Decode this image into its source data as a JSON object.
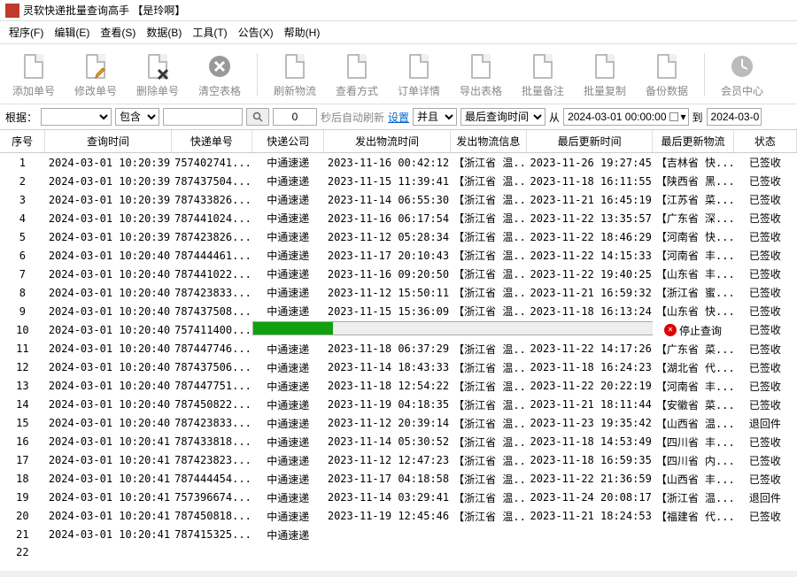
{
  "window": {
    "title": "灵软快递批量查询高手 【是玲啊】"
  },
  "menu": [
    "程序(F)",
    "编辑(E)",
    "查看(S)",
    "数据(B)",
    "工具(T)",
    "公告(X)",
    "帮助(H)"
  ],
  "toolbar": [
    {
      "label": "添加单号"
    },
    {
      "label": "修改单号"
    },
    {
      "label": "删除单号"
    },
    {
      "label": "清空表格"
    },
    {
      "sep": true
    },
    {
      "label": "刷新物流"
    },
    {
      "label": "查看方式"
    },
    {
      "label": "订单详情"
    },
    {
      "label": "导出表格"
    },
    {
      "label": "批量备注"
    },
    {
      "label": "批量复制"
    },
    {
      "label": "备份数据"
    },
    {
      "sep": true
    },
    {
      "label": "会员中心"
    }
  ],
  "filter": {
    "root_label": "根据：",
    "contains": "包含",
    "num": "0",
    "auto_refresh": "秒后自动刷新",
    "settings": "设置",
    "and": "并且",
    "last_query_time": "最后查询时间",
    "from": "从",
    "date1": "2024-03-01 00:00:00",
    "to": "到",
    "date2": "2024-03-0"
  },
  "columns": [
    "序号",
    "查询时间",
    "快递单号",
    "快递公司",
    "发出物流时间",
    "发出物流信息",
    "最后更新时间",
    "最后更新物流",
    "状态"
  ],
  "rows": [
    {
      "seq": "1",
      "qtime": "2024-03-01 10:20:39",
      "trackno": "757402741...",
      "company": "中通速递",
      "shiptime": "2023-11-16 00:42:12",
      "shipinfo": "【浙江省 温...",
      "lasttime": "2023-11-26 19:27:45",
      "lastinfo": "【吉林省 快...",
      "status": "已签收"
    },
    {
      "seq": "2",
      "qtime": "2024-03-01 10:20:39",
      "trackno": "787437504...",
      "company": "中通速递",
      "shiptime": "2023-11-15 11:39:41",
      "shipinfo": "【浙江省 温...",
      "lasttime": "2023-11-18 16:11:55",
      "lastinfo": "【陕西省 黑...",
      "status": "已签收"
    },
    {
      "seq": "3",
      "qtime": "2024-03-01 10:20:39",
      "trackno": "787433826...",
      "company": "中通速递",
      "shiptime": "2023-11-14 06:55:30",
      "shipinfo": "【浙江省 温...",
      "lasttime": "2023-11-21 16:45:19",
      "lastinfo": "【江苏省 菜...",
      "status": "已签收"
    },
    {
      "seq": "4",
      "qtime": "2024-03-01 10:20:39",
      "trackno": "787441024...",
      "company": "中通速递",
      "shiptime": "2023-11-16 06:17:54",
      "shipinfo": "【浙江省 温...",
      "lasttime": "2023-11-22 13:35:57",
      "lastinfo": "【广东省 深...",
      "status": "已签收"
    },
    {
      "seq": "5",
      "qtime": "2024-03-01 10:20:39",
      "trackno": "787423826...",
      "company": "中通速递",
      "shiptime": "2023-11-12 05:28:34",
      "shipinfo": "【浙江省 温...",
      "lasttime": "2023-11-22 18:46:29",
      "lastinfo": "【河南省 快...",
      "status": "已签收"
    },
    {
      "seq": "6",
      "qtime": "2024-03-01 10:20:40",
      "trackno": "787444461...",
      "company": "中通速递",
      "shiptime": "2023-11-17 20:10:43",
      "shipinfo": "【浙江省 温...",
      "lasttime": "2023-11-22 14:15:33",
      "lastinfo": "【河南省 丰...",
      "status": "已签收"
    },
    {
      "seq": "7",
      "qtime": "2024-03-01 10:20:40",
      "trackno": "787441022...",
      "company": "中通速递",
      "shiptime": "2023-11-16 09:20:50",
      "shipinfo": "【浙江省 温...",
      "lasttime": "2023-11-22 19:40:25",
      "lastinfo": "【山东省 丰...",
      "status": "已签收"
    },
    {
      "seq": "8",
      "qtime": "2024-03-01 10:20:40",
      "trackno": "787423833...",
      "company": "中通速递",
      "shiptime": "2023-11-12 15:50:11",
      "shipinfo": "【浙江省 温...",
      "lasttime": "2023-11-21 16:59:32",
      "lastinfo": "【浙江省 蜜...",
      "status": "已签收"
    },
    {
      "seq": "9",
      "qtime": "2024-03-01 10:20:40",
      "trackno": "787437508...",
      "company": "中通速递",
      "shiptime": "2023-11-15 15:36:09",
      "shipinfo": "【浙江省 温...",
      "lasttime": "2023-11-18 16:13:24",
      "lastinfo": "【山东省 快...",
      "status": "已签收"
    },
    {
      "seq": "10",
      "qtime": "2024-03-01 10:20:40",
      "trackno": "757411400...",
      "progress": true,
      "stop": "停止查询",
      "status": "已签收"
    },
    {
      "seq": "11",
      "qtime": "2024-03-01 10:20:40",
      "trackno": "787447746...",
      "company": "中通速递",
      "shiptime": "2023-11-18 06:37:29",
      "shipinfo": "【浙江省 温...",
      "lasttime": "2023-11-22 14:17:26",
      "lastinfo": "【广东省 菜...",
      "status": "已签收"
    },
    {
      "seq": "12",
      "qtime": "2024-03-01 10:20:40",
      "trackno": "787437506...",
      "company": "中通速递",
      "shiptime": "2023-11-14 18:43:33",
      "shipinfo": "【浙江省 温...",
      "lasttime": "2023-11-18 16:24:23",
      "lastinfo": "【湖北省 代...",
      "status": "已签收"
    },
    {
      "seq": "13",
      "qtime": "2024-03-01 10:20:40",
      "trackno": "787447751...",
      "company": "中通速递",
      "shiptime": "2023-11-18 12:54:22",
      "shipinfo": "【浙江省 温...",
      "lasttime": "2023-11-22 20:22:19",
      "lastinfo": "【河南省 丰...",
      "status": "已签收"
    },
    {
      "seq": "14",
      "qtime": "2024-03-01 10:20:40",
      "trackno": "787450822...",
      "company": "中通速递",
      "shiptime": "2023-11-19 04:18:35",
      "shipinfo": "【浙江省 温...",
      "lasttime": "2023-11-21 18:11:44",
      "lastinfo": "【安徽省 菜...",
      "status": "已签收"
    },
    {
      "seq": "15",
      "qtime": "2024-03-01 10:20:40",
      "trackno": "787423833...",
      "company": "中通速递",
      "shiptime": "2023-11-12 20:39:14",
      "shipinfo": "【浙江省 温...",
      "lasttime": "2023-11-23 19:35:42",
      "lastinfo": "【山西省 温...",
      "status": "退回件"
    },
    {
      "seq": "16",
      "qtime": "2024-03-01 10:20:41",
      "trackno": "787433818...",
      "company": "中通速递",
      "shiptime": "2023-11-14 05:30:52",
      "shipinfo": "【浙江省 温...",
      "lasttime": "2023-11-18 14:53:49",
      "lastinfo": "【四川省 丰...",
      "status": "已签收"
    },
    {
      "seq": "17",
      "qtime": "2024-03-01 10:20:41",
      "trackno": "787423823...",
      "company": "中通速递",
      "shiptime": "2023-11-12 12:47:23",
      "shipinfo": "【浙江省 温...",
      "lasttime": "2023-11-18 16:59:35",
      "lastinfo": "【四川省 内...",
      "status": "已签收"
    },
    {
      "seq": "18",
      "qtime": "2024-03-01 10:20:41",
      "trackno": "787444454...",
      "company": "中通速递",
      "shiptime": "2023-11-17 04:18:58",
      "shipinfo": "【浙江省 温...",
      "lasttime": "2023-11-22 21:36:59",
      "lastinfo": "【山西省 丰...",
      "status": "已签收"
    },
    {
      "seq": "19",
      "qtime": "2024-03-01 10:20:41",
      "trackno": "757396674...",
      "company": "中通速递",
      "shiptime": "2023-11-14 03:29:41",
      "shipinfo": "【浙江省 温...",
      "lasttime": "2023-11-24 20:08:17",
      "lastinfo": "【浙江省 温...",
      "status": "退回件"
    },
    {
      "seq": "20",
      "qtime": "2024-03-01 10:20:41",
      "trackno": "787450818...",
      "company": "中通速递",
      "shiptime": "2023-11-19 12:45:46",
      "shipinfo": "【浙江省 温...",
      "lasttime": "2023-11-21 18:24:53",
      "lastinfo": "【福建省 代...",
      "status": "已签收"
    },
    {
      "seq": "21",
      "qtime": "2024-03-01 10:20:41",
      "trackno": "787415325...",
      "company": "中通速递",
      "shiptime": "",
      "shipinfo": "",
      "lasttime": "",
      "lastinfo": "",
      "status": ""
    },
    {
      "seq": "22",
      "qtime": "",
      "trackno": "",
      "company": "",
      "shiptime": "",
      "shipinfo": "",
      "lasttime": "",
      "lastinfo": "",
      "status": ""
    }
  ]
}
